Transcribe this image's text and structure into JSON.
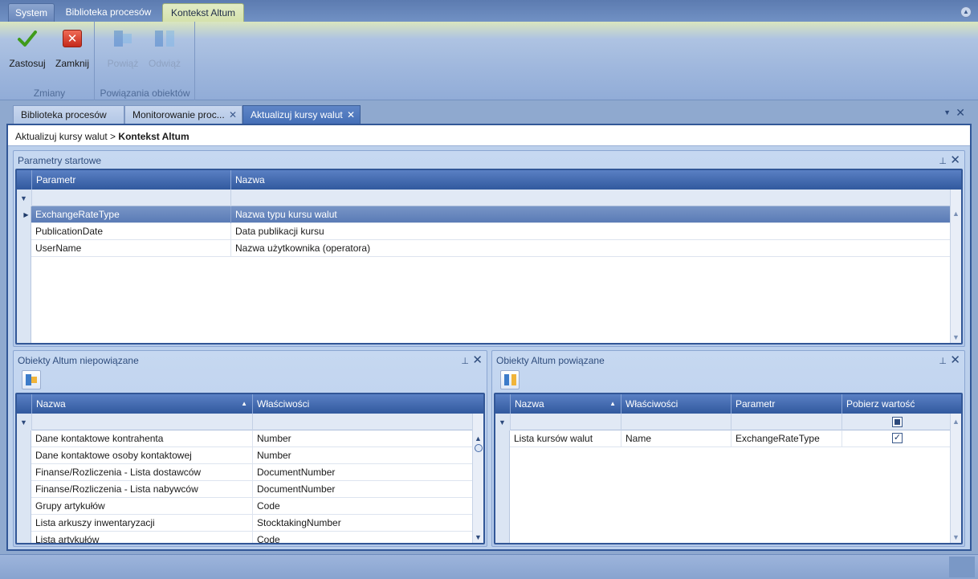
{
  "ribbon_tabs": [
    "System",
    "Biblioteka procesów",
    "Kontekst Altum"
  ],
  "ribbon": {
    "groups": [
      {
        "label": "Zmiany",
        "buttons": [
          {
            "label": "Zastosuj",
            "icon": "checkmark-icon"
          },
          {
            "label": "Zamknij",
            "icon": "close-icon"
          }
        ]
      },
      {
        "label": "Powiązania obiektów",
        "buttons": [
          {
            "label": "Powiąż",
            "icon": "link-icon"
          },
          {
            "label": "Odwiąż",
            "icon": "unlink-icon"
          }
        ]
      }
    ]
  },
  "doc_tabs": [
    {
      "label": "Biblioteka procesów"
    },
    {
      "label": "Monitorowanie proc...",
      "close": "✕"
    },
    {
      "label": "Aktualizuj kursy walut",
      "close": "✕",
      "active": true
    }
  ],
  "breadcrumb": {
    "path": "Aktualizuj kursy walut >",
    "current": "Kontekst Altum"
  },
  "params_panel": {
    "title": "Parametry startowe",
    "columns": [
      "Parametr",
      "Nazwa"
    ],
    "rows": [
      [
        "ExchangeRateType",
        "Nazwa typu kursu walut"
      ],
      [
        "PublicationDate",
        "Data publikacji kursu"
      ],
      [
        "UserName",
        "Nazwa użytkownika (operatora)"
      ]
    ],
    "selected_row": 0
  },
  "unlinked_panel": {
    "title": "Obiekty Altum niepowiązane",
    "columns": [
      "Nazwa",
      "Właściwości"
    ],
    "rows": [
      [
        "Dane kontaktowe kontrahenta",
        "Number"
      ],
      [
        "Dane kontaktowe osoby kontaktowej",
        "Number"
      ],
      [
        "Finanse/Rozliczenia - Lista dostawców",
        "DocumentNumber"
      ],
      [
        "Finanse/Rozliczenia - Lista nabywców",
        "DocumentNumber"
      ],
      [
        "Grupy artykułów",
        "Code"
      ],
      [
        "Lista arkuszy inwentaryzacji",
        "StocktakingNumber"
      ],
      [
        "Lista artykułów",
        "Code"
      ]
    ]
  },
  "linked_panel": {
    "title": "Obiekty Altum powiązane",
    "columns": [
      "Nazwa",
      "Właściwości",
      "Parametr",
      "Pobierz wartość"
    ],
    "rows": [
      {
        "cells": [
          "Lista kursów walut",
          "Name",
          "ExchangeRateType"
        ],
        "checked": true
      }
    ]
  },
  "colors": {
    "accent": "#325797",
    "ribbon_active_tab": "#d4e1ac",
    "selected_row": "#6384bd"
  }
}
